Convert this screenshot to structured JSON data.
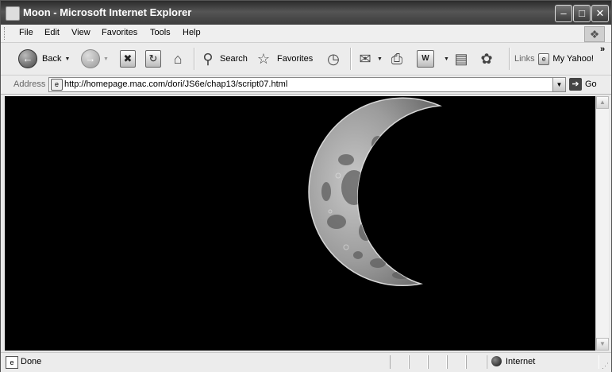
{
  "window": {
    "title": "Moon - Microsoft Internet Explorer"
  },
  "menu": [
    "File",
    "Edit",
    "View",
    "Favorites",
    "Tools",
    "Help"
  ],
  "toolbar": {
    "back": "Back",
    "search": "Search",
    "favorites": "Favorites",
    "links": "Links",
    "my_yahoo": "My Yahoo!"
  },
  "address": {
    "label": "Address",
    "url": "http://homepage.mac.com/dori/JS6e/chap13/script07.html",
    "go": "Go"
  },
  "status": {
    "text": "Done",
    "zone": "Internet"
  }
}
